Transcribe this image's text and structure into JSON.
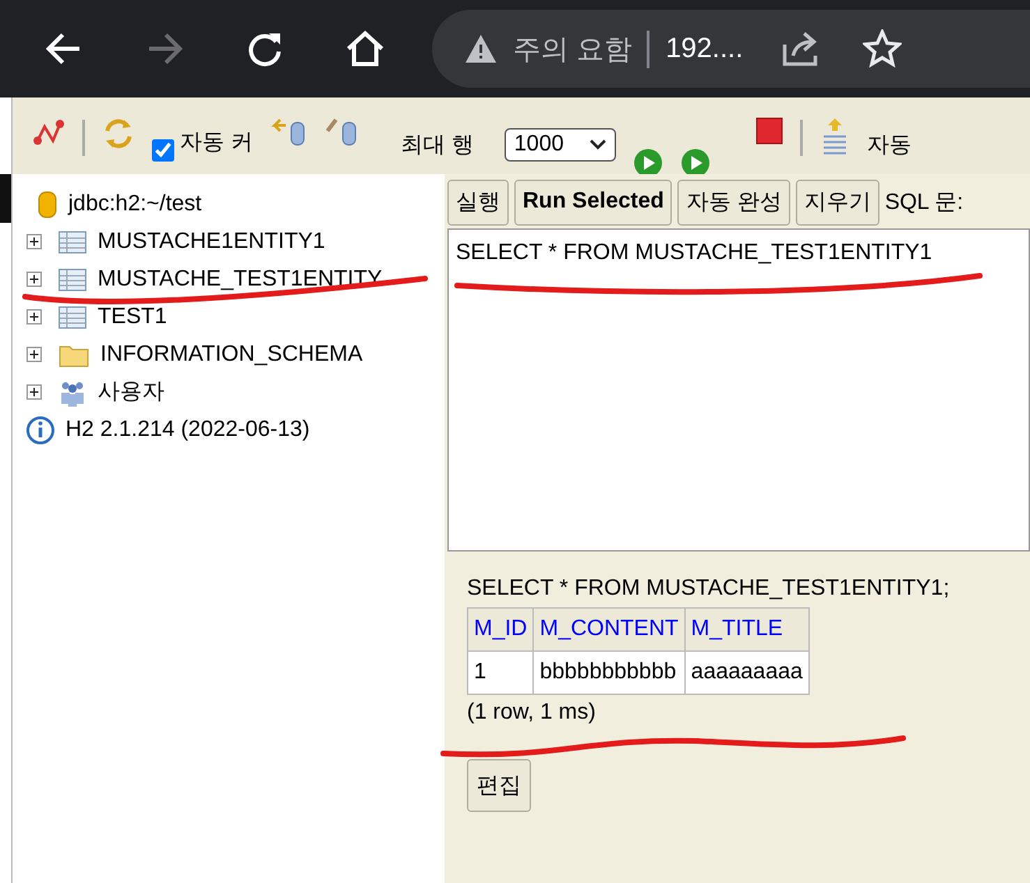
{
  "browser": {
    "back_enabled": true,
    "forward_enabled": false,
    "security_label": "주의 요함",
    "url": "192...."
  },
  "toolbar": {
    "auto_commit": {
      "label": "자동 커",
      "checked": true
    },
    "max_rows": {
      "label": "최대 행",
      "value": "1000"
    },
    "auto_label": "자동"
  },
  "tree": {
    "connection": "jdbc:h2:~/test",
    "items": [
      {
        "kind": "table",
        "label": "MUSTACHE1ENTITY1"
      },
      {
        "kind": "table",
        "label": "MUSTACHE_TEST1ENTITY"
      },
      {
        "kind": "table",
        "label": "TEST1"
      },
      {
        "kind": "folder",
        "label": "INFORMATION_SCHEMA"
      },
      {
        "kind": "users",
        "label": "사용자"
      }
    ],
    "version": "H2 2.1.214 (2022-06-13)"
  },
  "query": {
    "buttons": [
      {
        "label": "실행",
        "bold": false
      },
      {
        "label": "Run Selected",
        "bold": true
      },
      {
        "label": "자동 완성",
        "bold": false
      },
      {
        "label": "지우기",
        "bold": false
      }
    ],
    "sql_label": "SQL 문:",
    "text": "SELECT * FROM MUSTACHE_TEST1ENTITY1"
  },
  "result": {
    "statement": "SELECT * FROM MUSTACHE_TEST1ENTITY1;",
    "columns": [
      "M_ID",
      "M_CONTENT",
      "M_TITLE"
    ],
    "rows": [
      [
        "1",
        "bbbbbbbbbbb",
        "aaaaaaaaa"
      ]
    ],
    "summary": "(1 row, 1 ms)",
    "edit_button": "편집"
  }
}
